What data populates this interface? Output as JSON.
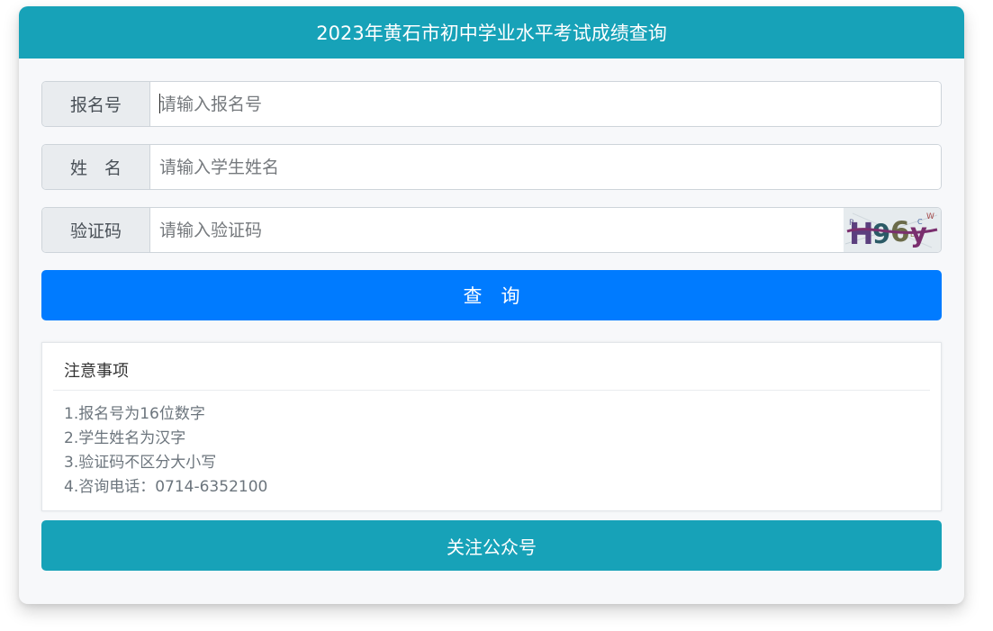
{
  "header": {
    "title": "2023年黄石市初中学业水平考试成绩查询"
  },
  "form": {
    "registration": {
      "label": "报名号",
      "placeholder": "请输入报名号",
      "value": ""
    },
    "name": {
      "label": "姓　名",
      "placeholder": "请输入学生姓名",
      "value": ""
    },
    "captcha": {
      "label": "验证码",
      "placeholder": "请输入验证码",
      "value": "",
      "image_text": "H96y",
      "noise_text": "WCPL"
    }
  },
  "buttons": {
    "query": "查　询",
    "follow": "关注公众号"
  },
  "notice": {
    "title": "注意事项",
    "items": [
      "1.报名号为16位数字",
      "2.学生姓名为汉字",
      "3.验证码不区分大小写",
      "4.咨询电话：0714-6352100"
    ]
  },
  "colors": {
    "header_bg": "#17a2b8",
    "primary": "#007bff",
    "teal": "#17a2b8"
  }
}
